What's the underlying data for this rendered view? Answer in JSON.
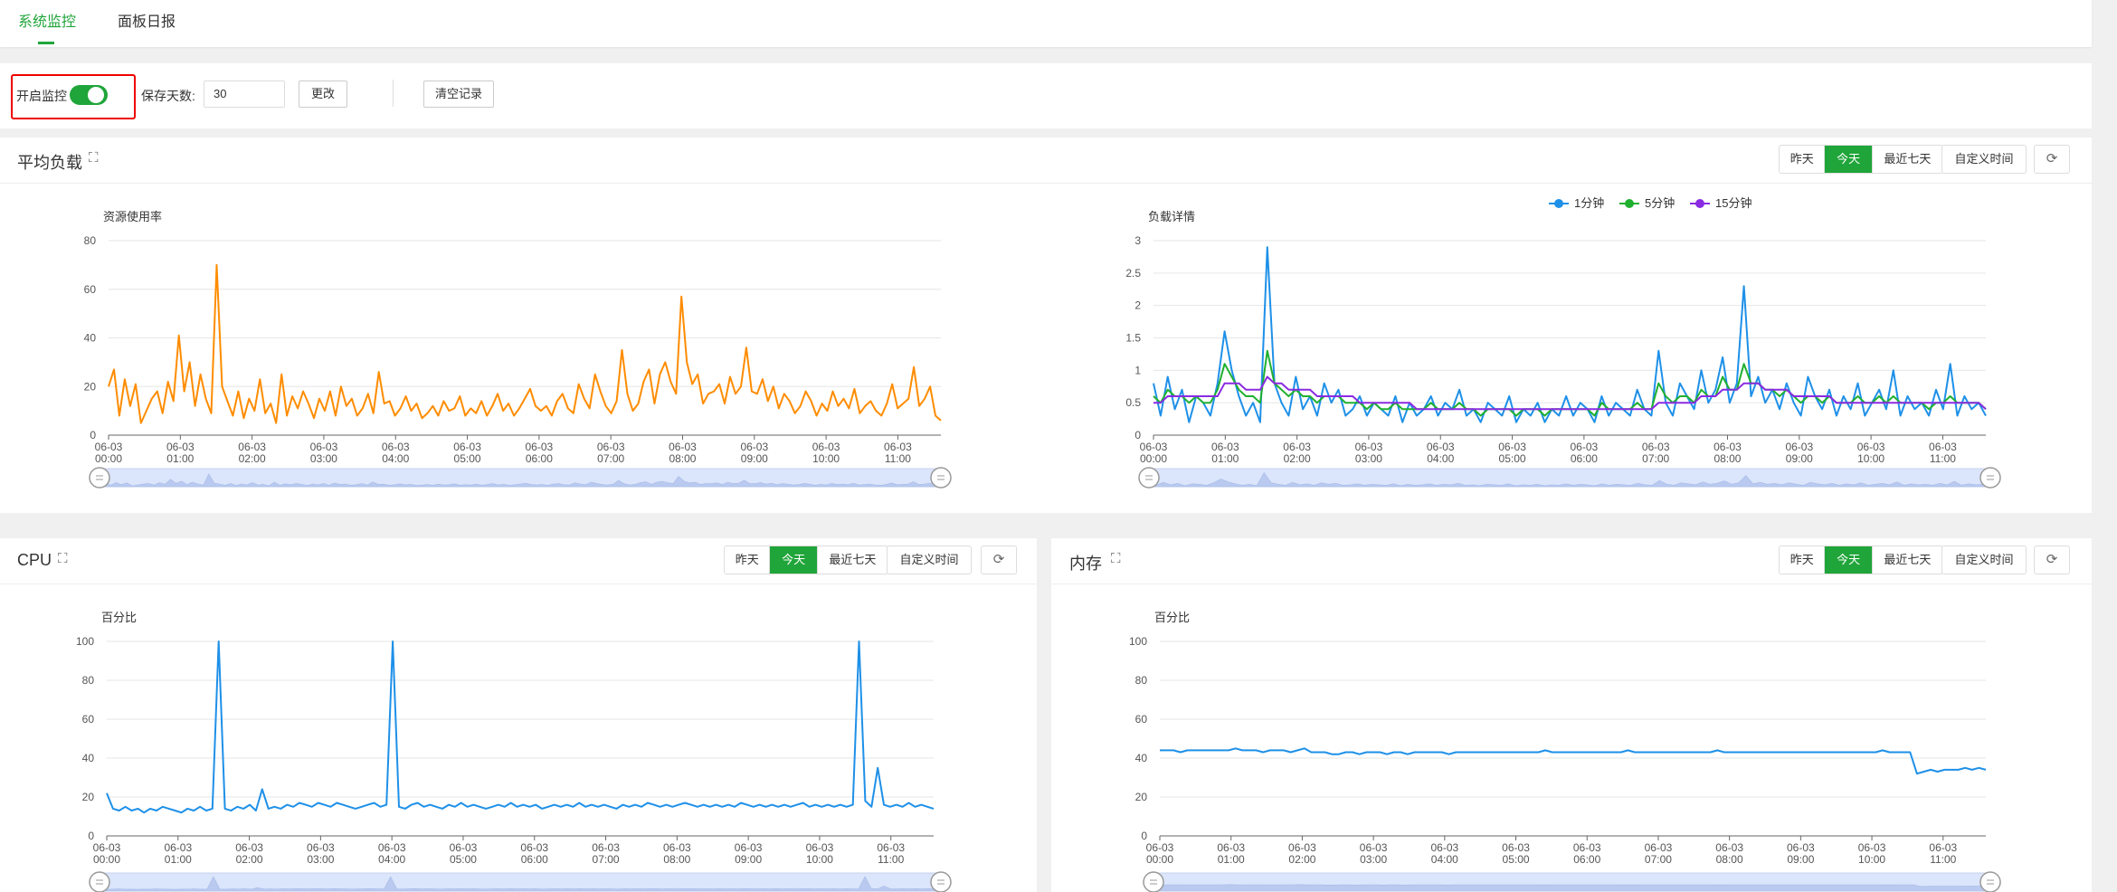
{
  "tabs": [
    {
      "label": "系统监控",
      "active": true
    },
    {
      "label": "面板日报",
      "active": false
    }
  ],
  "settings": {
    "enable_label": "开启监控",
    "enabled": true,
    "days_label": "保存天数:",
    "days_value": "30",
    "change_label": "更改",
    "clear_label": "清空记录"
  },
  "range_options": [
    "昨天",
    "今天",
    "最近七天",
    "自定义时间"
  ],
  "range_selected": "今天",
  "icons": {
    "expand": "expand-icon",
    "refresh": "refresh-icon"
  },
  "colors": {
    "accent": "#20a53a",
    "orange": "#ff8c00",
    "blue": "#1e90e8",
    "green": "#20b030",
    "purple": "#8a2be2",
    "slider": "#dbe5fb"
  },
  "load_panel": {
    "title": "平均负载"
  },
  "cpu_panel": {
    "title": "CPU"
  },
  "mem_panel": {
    "title": "内存"
  },
  "chart_data": [
    {
      "id": "load-usage",
      "type": "line",
      "title": "资源使用率",
      "ylim": [
        0,
        80
      ],
      "yticks": [
        0,
        20,
        40,
        60,
        80
      ],
      "xticks": [
        "06-03\n00:00",
        "06-03\n01:00",
        "06-03\n02:00",
        "06-03\n03:00",
        "06-03\n04:00",
        "06-03\n05:00",
        "06-03\n06:00",
        "06-03\n07:00",
        "06-03\n08:00",
        "06-03\n09:00",
        "06-03\n10:00",
        "06-03\n11:00"
      ],
      "series": [
        {
          "color": "#ff8c00",
          "values": [
            20,
            27,
            8,
            23,
            12,
            21,
            5,
            10,
            15,
            18,
            9,
            22,
            14,
            41,
            18,
            30,
            12,
            25,
            15,
            9,
            70,
            20,
            14,
            8,
            18,
            7,
            15,
            10,
            23,
            9,
            13,
            5,
            25,
            8,
            16,
            11,
            18,
            13,
            7,
            15,
            10,
            18,
            8,
            20,
            12,
            15,
            8,
            11,
            17,
            9,
            26,
            13,
            14,
            8,
            11,
            16,
            10,
            13,
            7,
            9,
            12,
            8,
            14,
            10,
            11,
            16,
            8,
            11,
            9,
            14,
            8,
            12,
            17,
            10,
            13,
            8,
            11,
            15,
            19,
            12,
            10,
            12,
            8,
            14,
            17,
            11,
            9,
            21,
            15,
            11,
            25,
            18,
            12,
            9,
            14,
            35,
            17,
            10,
            13,
            22,
            27,
            13,
            25,
            30,
            22,
            17,
            57,
            30,
            21,
            25,
            13,
            17,
            18,
            21,
            13,
            24,
            17,
            20,
            36,
            18,
            17,
            23,
            14,
            20,
            11,
            17,
            14,
            9,
            12,
            18,
            14,
            8,
            13,
            10,
            18,
            12,
            15,
            11,
            19,
            9,
            12,
            14,
            10,
            8,
            13,
            21,
            11,
            13,
            15,
            28,
            12,
            15,
            20,
            8,
            6
          ]
        }
      ]
    },
    {
      "id": "load-detail",
      "type": "line",
      "title": "负载详情",
      "ylim": [
        0,
        3
      ],
      "yticks": [
        0,
        0.5,
        1,
        1.5,
        2,
        2.5,
        3
      ],
      "xticks": [
        "06-03\n00:00",
        "06-03\n01:00",
        "06-03\n02:00",
        "06-03\n03:00",
        "06-03\n04:00",
        "06-03\n05:00",
        "06-03\n06:00",
        "06-03\n07:00",
        "06-03\n08:00",
        "06-03\n09:00",
        "06-03\n10:00",
        "06-03\n11:00"
      ],
      "series": [
        {
          "name": "1分钟",
          "color": "#1e90e8",
          "values": [
            0.8,
            0.3,
            0.9,
            0.4,
            0.7,
            0.2,
            0.6,
            0.5,
            0.3,
            0.8,
            1.6,
            1.0,
            0.6,
            0.3,
            0.5,
            0.2,
            2.9,
            0.8,
            0.5,
            0.3,
            0.9,
            0.4,
            0.6,
            0.3,
            0.8,
            0.5,
            0.7,
            0.3,
            0.4,
            0.6,
            0.3,
            0.5,
            0.4,
            0.3,
            0.6,
            0.2,
            0.5,
            0.3,
            0.4,
            0.6,
            0.3,
            0.5,
            0.4,
            0.7,
            0.3,
            0.4,
            0.2,
            0.5,
            0.4,
            0.3,
            0.6,
            0.2,
            0.4,
            0.3,
            0.5,
            0.2,
            0.4,
            0.3,
            0.6,
            0.3,
            0.5,
            0.4,
            0.2,
            0.6,
            0.3,
            0.5,
            0.4,
            0.3,
            0.7,
            0.4,
            0.3,
            1.3,
            0.5,
            0.3,
            0.8,
            0.6,
            0.4,
            1.0,
            0.5,
            0.7,
            1.2,
            0.5,
            0.8,
            2.3,
            0.6,
            0.9,
            0.5,
            0.7,
            0.4,
            0.8,
            0.5,
            0.3,
            0.9,
            0.6,
            0.4,
            0.7,
            0.3,
            0.6,
            0.4,
            0.8,
            0.3,
            0.5,
            0.7,
            0.4,
            1.0,
            0.3,
            0.6,
            0.4,
            0.5,
            0.3,
            0.7,
            0.4,
            1.1,
            0.3,
            0.6,
            0.4,
            0.5,
            0.3
          ]
        },
        {
          "name": "5分钟",
          "color": "#20b030",
          "values": [
            0.6,
            0.5,
            0.7,
            0.6,
            0.6,
            0.5,
            0.6,
            0.5,
            0.5,
            0.7,
            1.1,
            0.9,
            0.7,
            0.6,
            0.6,
            0.5,
            1.3,
            0.8,
            0.7,
            0.6,
            0.7,
            0.6,
            0.6,
            0.5,
            0.6,
            0.6,
            0.6,
            0.5,
            0.5,
            0.5,
            0.4,
            0.5,
            0.4,
            0.4,
            0.5,
            0.4,
            0.4,
            0.4,
            0.4,
            0.5,
            0.4,
            0.4,
            0.4,
            0.5,
            0.4,
            0.4,
            0.3,
            0.4,
            0.4,
            0.4,
            0.4,
            0.3,
            0.4,
            0.4,
            0.4,
            0.3,
            0.4,
            0.4,
            0.4,
            0.4,
            0.4,
            0.4,
            0.3,
            0.5,
            0.4,
            0.4,
            0.4,
            0.4,
            0.5,
            0.4,
            0.4,
            0.8,
            0.6,
            0.5,
            0.6,
            0.6,
            0.5,
            0.7,
            0.6,
            0.6,
            0.9,
            0.7,
            0.7,
            1.1,
            0.8,
            0.8,
            0.7,
            0.7,
            0.6,
            0.7,
            0.6,
            0.5,
            0.6,
            0.6,
            0.5,
            0.6,
            0.5,
            0.5,
            0.5,
            0.6,
            0.5,
            0.5,
            0.6,
            0.5,
            0.6,
            0.5,
            0.5,
            0.5,
            0.5,
            0.4,
            0.5,
            0.5,
            0.6,
            0.5,
            0.5,
            0.5,
            0.5,
            0.4
          ]
        },
        {
          "name": "15分钟",
          "color": "#8a2be2",
          "values": [
            0.5,
            0.5,
            0.6,
            0.6,
            0.6,
            0.6,
            0.6,
            0.6,
            0.6,
            0.6,
            0.8,
            0.8,
            0.8,
            0.7,
            0.7,
            0.7,
            0.9,
            0.8,
            0.8,
            0.7,
            0.7,
            0.7,
            0.7,
            0.6,
            0.6,
            0.6,
            0.6,
            0.6,
            0.6,
            0.5,
            0.5,
            0.5,
            0.5,
            0.5,
            0.5,
            0.5,
            0.5,
            0.4,
            0.4,
            0.4,
            0.4,
            0.4,
            0.4,
            0.4,
            0.4,
            0.4,
            0.4,
            0.4,
            0.4,
            0.4,
            0.4,
            0.4,
            0.4,
            0.4,
            0.4,
            0.4,
            0.4,
            0.4,
            0.4,
            0.4,
            0.4,
            0.4,
            0.4,
            0.4,
            0.4,
            0.4,
            0.4,
            0.4,
            0.4,
            0.4,
            0.4,
            0.5,
            0.5,
            0.5,
            0.5,
            0.5,
            0.5,
            0.6,
            0.6,
            0.6,
            0.7,
            0.7,
            0.7,
            0.8,
            0.8,
            0.8,
            0.7,
            0.7,
            0.7,
            0.7,
            0.6,
            0.6,
            0.6,
            0.6,
            0.6,
            0.6,
            0.5,
            0.5,
            0.5,
            0.5,
            0.5,
            0.5,
            0.5,
            0.5,
            0.5,
            0.5,
            0.5,
            0.5,
            0.5,
            0.5,
            0.5,
            0.5,
            0.5,
            0.5,
            0.5,
            0.5,
            0.5,
            0.4
          ]
        }
      ]
    },
    {
      "id": "cpu",
      "type": "line",
      "title": "百分比",
      "ylim": [
        0,
        100
      ],
      "yticks": [
        0,
        20,
        40,
        60,
        80,
        100
      ],
      "xticks": [
        "06-03\n00:00",
        "06-03\n01:00",
        "06-03\n02:00",
        "06-03\n03:00",
        "06-03\n04:00",
        "06-03\n05:00",
        "06-03\n06:00",
        "06-03\n07:00",
        "06-03\n08:00",
        "06-03\n09:00",
        "06-03\n10:00",
        "06-03\n11:00"
      ],
      "series": [
        {
          "color": "#1e90e8",
          "values": [
            22,
            14,
            13,
            15,
            13,
            14,
            12,
            14,
            13,
            15,
            14,
            13,
            12,
            14,
            13,
            15,
            13,
            14,
            100,
            14,
            13,
            15,
            14,
            16,
            13,
            24,
            14,
            15,
            14,
            16,
            15,
            17,
            16,
            15,
            17,
            16,
            15,
            17,
            16,
            15,
            14,
            15,
            16,
            17,
            15,
            16,
            100,
            15,
            14,
            16,
            17,
            15,
            16,
            15,
            14,
            16,
            15,
            17,
            15,
            16,
            15,
            14,
            15,
            16,
            15,
            17,
            15,
            16,
            15,
            16,
            14,
            15,
            16,
            15,
            16,
            15,
            17,
            15,
            16,
            15,
            16,
            15,
            14,
            16,
            15,
            16,
            15,
            17,
            16,
            15,
            16,
            15,
            16,
            17,
            16,
            15,
            16,
            15,
            16,
            15,
            16,
            15,
            17,
            16,
            15,
            16,
            15,
            16,
            15,
            16,
            15,
            16,
            17,
            15,
            16,
            15,
            16,
            15,
            16,
            15,
            16,
            100,
            18,
            15,
            35,
            16,
            15,
            16,
            15,
            17,
            15,
            16,
            15,
            14
          ]
        }
      ]
    },
    {
      "id": "mem",
      "type": "line",
      "title": "百分比",
      "ylim": [
        0,
        100
      ],
      "yticks": [
        0,
        20,
        40,
        60,
        80,
        100
      ],
      "xticks": [
        "06-03\n00:00",
        "06-03\n01:00",
        "06-03\n02:00",
        "06-03\n03:00",
        "06-03\n04:00",
        "06-03\n05:00",
        "06-03\n06:00",
        "06-03\n07:00",
        "06-03\n08:00",
        "06-03\n09:00",
        "06-03\n10:00",
        "06-03\n11:00"
      ],
      "series": [
        {
          "color": "#1e90e8",
          "values": [
            44,
            44,
            44,
            43,
            44,
            44,
            44,
            44,
            44,
            44,
            44,
            45,
            44,
            44,
            44,
            43,
            44,
            44,
            44,
            43,
            44,
            45,
            43,
            43,
            43,
            42,
            42,
            43,
            43,
            42,
            43,
            43,
            43,
            42,
            43,
            43,
            42,
            43,
            43,
            43,
            43,
            43,
            42,
            43,
            43,
            43,
            43,
            43,
            43,
            43,
            43,
            43,
            43,
            43,
            43,
            43,
            44,
            43,
            43,
            43,
            43,
            43,
            43,
            43,
            43,
            43,
            43,
            43,
            44,
            43,
            43,
            43,
            43,
            43,
            43,
            43,
            43,
            43,
            43,
            43,
            43,
            44,
            43,
            43,
            43,
            43,
            43,
            43,
            43,
            43,
            43,
            43,
            43,
            43,
            43,
            43,
            43,
            43,
            43,
            43,
            43,
            43,
            43,
            43,
            43,
            44,
            43,
            43,
            43,
            43,
            32,
            33,
            34,
            33,
            34,
            34,
            34,
            35,
            34,
            35,
            34
          ]
        }
      ]
    }
  ]
}
